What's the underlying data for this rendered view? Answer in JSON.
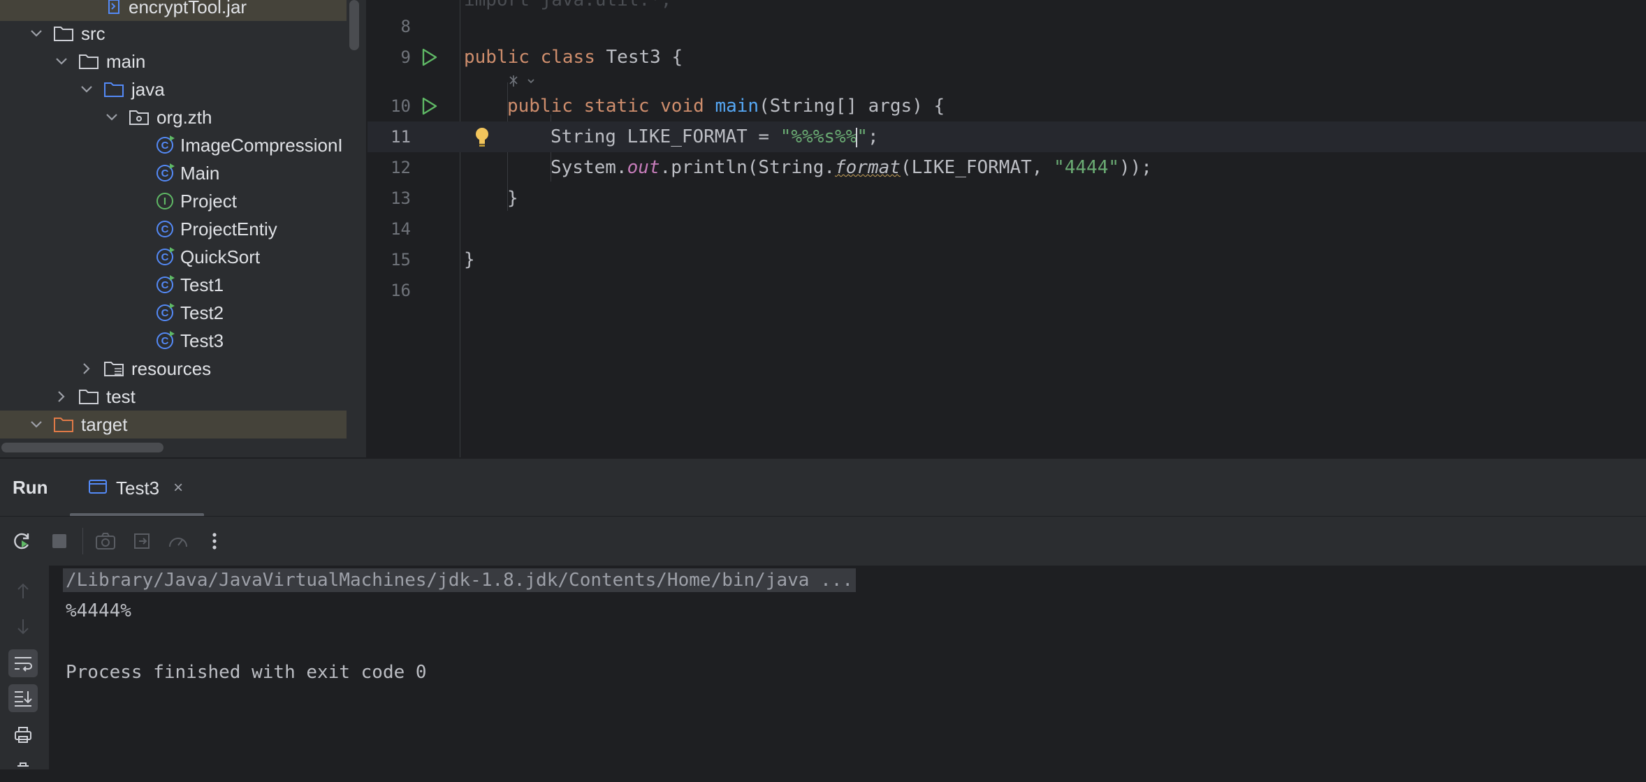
{
  "project_tree": {
    "items": [
      {
        "label": "encryptTool.jar",
        "kind": "jar",
        "depth": 3,
        "expanded": null
      },
      {
        "label": "src",
        "kind": "folder",
        "depth": 1,
        "expanded": true
      },
      {
        "label": "main",
        "kind": "folder",
        "depth": 2,
        "expanded": true
      },
      {
        "label": "java",
        "kind": "source-folder",
        "depth": 3,
        "expanded": true
      },
      {
        "label": "org.zth",
        "kind": "package",
        "depth": 4,
        "expanded": true
      },
      {
        "label": "ImageCompressionI",
        "kind": "class",
        "depth": 5
      },
      {
        "label": "Main",
        "kind": "class",
        "depth": 5
      },
      {
        "label": "Project",
        "kind": "interface",
        "depth": 5
      },
      {
        "label": "ProjectEntiy",
        "kind": "class-plain",
        "depth": 5
      },
      {
        "label": "QuickSort",
        "kind": "class",
        "depth": 5
      },
      {
        "label": "Test1",
        "kind": "class",
        "depth": 5
      },
      {
        "label": "Test2",
        "kind": "class",
        "depth": 5
      },
      {
        "label": "Test3",
        "kind": "class",
        "depth": 5
      },
      {
        "label": "resources",
        "kind": "resources-folder",
        "depth": 3,
        "expanded": false
      },
      {
        "label": "test",
        "kind": "folder",
        "depth": 2,
        "expanded": false
      },
      {
        "label": "target",
        "kind": "excluded-folder",
        "depth": 1,
        "expanded": true
      }
    ]
  },
  "editor": {
    "top_partial": "import java.util.*;",
    "lines": [
      {
        "num": "8",
        "text": ""
      },
      {
        "num": "9",
        "text": "public class Test3 {"
      },
      {
        "num": "10",
        "text": "public static void main(String[] args) {"
      },
      {
        "num": "11",
        "text": "String LIKE_FORMAT = \"%%%s%%\";"
      },
      {
        "num": "12",
        "text": "System.out.println(String.format(LIKE_FORMAT, \"4444\"));"
      },
      {
        "num": "13",
        "text": "}"
      },
      {
        "num": "14",
        "text": ""
      },
      {
        "num": "15",
        "text": "}"
      },
      {
        "num": "16",
        "text": ""
      }
    ],
    "tokens": {
      "kw_public": "public",
      "kw_class": "class",
      "class_name": "Test3",
      "open_brace": "{",
      "kw_static": "static",
      "kw_void": "void",
      "fn_main": "main",
      "main_params": "(String[] args) {",
      "type_string": "String",
      "var_name": " LIKE_FORMAT = ",
      "str_format": "\"%%%s%%",
      "str_format_end": "\"",
      "semicolon": ";",
      "system": "System.",
      "field_out": "out",
      "println": ".println(String.",
      "fn_format": "format",
      "format_args": "(LIKE_FORMAT, ",
      "str_4444": "\"4444\"",
      "close_call": "));",
      "close_brace": "}"
    },
    "current_line": "11"
  },
  "run_panel": {
    "title": "Run",
    "tab_label": "Test3",
    "tab_close": "×",
    "console": {
      "command": "/Library/Java/JavaVirtualMachines/jdk-1.8.jdk/Contents/Home/bin/java ...",
      "output": "%4444%",
      "exit_message": "Process finished with exit code 0"
    }
  },
  "colors": {
    "keyword": "#cf8e6d",
    "function": "#56a8f5",
    "string": "#6aab73",
    "field": "#c77dbb",
    "run_green": "#5fb865",
    "class_blue": "#548af7"
  }
}
